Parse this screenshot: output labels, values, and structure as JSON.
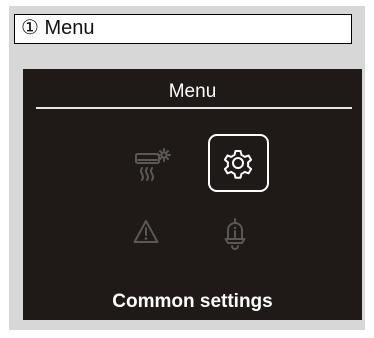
{
  "caption": {
    "text": "① Menu"
  },
  "screen": {
    "title": "Menu",
    "selected_label": "Common settings",
    "items": [
      {
        "icon": "air-conditioner-settings-icon",
        "selected": false
      },
      {
        "icon": "gear-icon",
        "selected": true
      },
      {
        "icon": "warning-icon",
        "selected": false
      },
      {
        "icon": "bell-info-icon",
        "selected": false
      }
    ]
  },
  "colors": {
    "screen_background": "#1f1a17",
    "frame_background": "#d7d7d7",
    "active_icon": "#ffffff",
    "inactive_icon": "#5b5754"
  }
}
